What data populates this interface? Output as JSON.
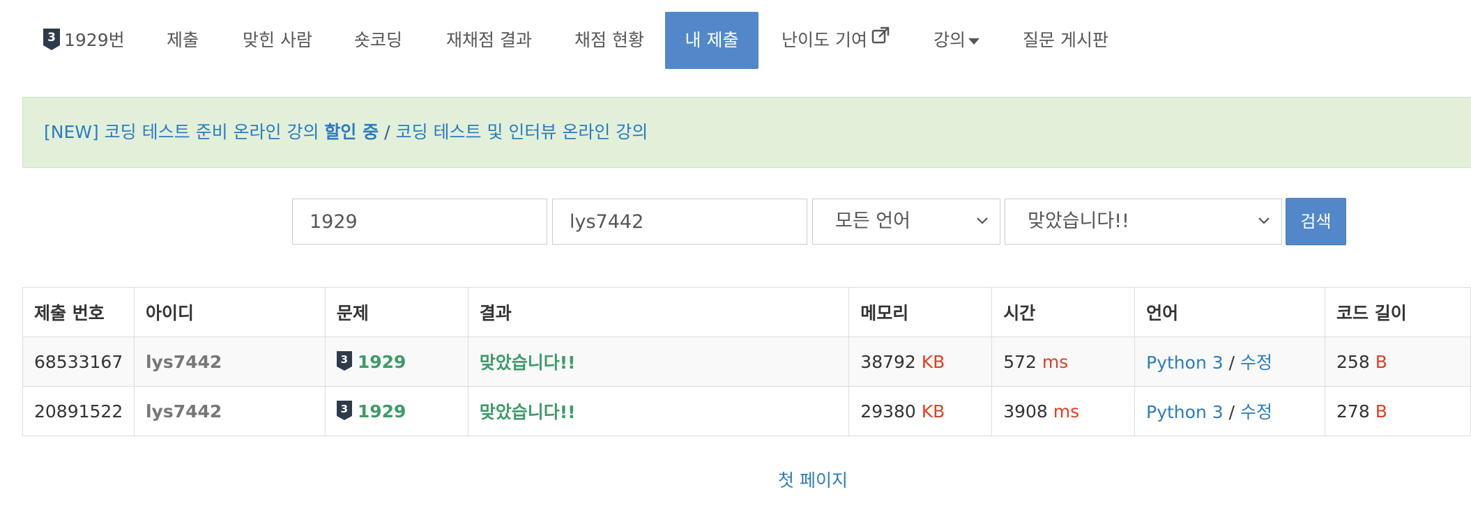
{
  "nav": {
    "problem": {
      "tier": "3",
      "label": "1929번"
    },
    "submit": "제출",
    "solvers": "맞힌 사람",
    "short_coding": "숏코딩",
    "rejudge": "재채점 결과",
    "status": "채점 현황",
    "my_submissions": "내 제출",
    "difficulty": "난이도 기여",
    "lecture": "강의",
    "board": "질문 게시판"
  },
  "banner": {
    "part1": "[NEW] 코딩 테스트 준비 온라인 강의",
    "part1_strong": "할인 중",
    "separator": "/",
    "part2": "코딩 테스트 및 인터뷰 온라인 강의"
  },
  "search": {
    "problem_id": "1929",
    "user_id": "lys7442",
    "language": "모든 언어",
    "result": "맞았습니다!!",
    "button": "검색"
  },
  "table": {
    "headers": [
      "제출 번호",
      "아이디",
      "문제",
      "결과",
      "메모리",
      "시간",
      "언어",
      "코드 길이"
    ],
    "rows": [
      {
        "id": "68533167",
        "user": "lys7442",
        "tier": "3",
        "problem": "1929",
        "result": "맞았습니다!!",
        "memory": "38792",
        "memory_unit": "KB",
        "time": "572",
        "time_unit": "ms",
        "language": "Python 3",
        "edit": "수정",
        "length": "258",
        "length_unit": "B"
      },
      {
        "id": "20891522",
        "user": "lys7442",
        "tier": "3",
        "problem": "1929",
        "result": "맞았습니다!!",
        "memory": "29380",
        "memory_unit": "KB",
        "time": "3908",
        "time_unit": "ms",
        "language": "Python 3",
        "edit": "수정",
        "length": "278",
        "length_unit": "B"
      }
    ]
  },
  "pagination": {
    "first": "첫 페이지"
  },
  "colors": {
    "accent": "#5288c9",
    "link": "#2b7bc0",
    "accepted": "#3f9b6a",
    "unit": "#dd4124",
    "banner_bg": "#e2f0da",
    "tier_badge": "#2f3a4b"
  },
  "icons": [
    "tier-badge-icon",
    "external-link-icon",
    "caret-down-icon",
    "chevron-down-icon"
  ]
}
